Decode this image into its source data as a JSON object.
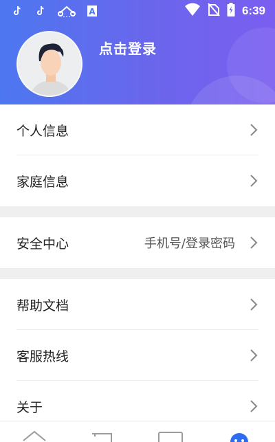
{
  "status_bar": {
    "time": "6:39",
    "icons": [
      "tiktok-icon",
      "tiktok-icon",
      "cast-icon",
      "keyboard-a-icon",
      "wifi-icon",
      "no-sim-icon",
      "battery-icon"
    ]
  },
  "header": {
    "login_text": "点击登录",
    "avatar": "default-avatar"
  },
  "menu": {
    "group1": [
      {
        "label": "个人信息"
      },
      {
        "label": "家庭信息"
      }
    ],
    "group2": [
      {
        "label": "安全中心",
        "value": "手机号/登录密码"
      }
    ],
    "group3": [
      {
        "label": "帮助文档"
      },
      {
        "label": "客服热线"
      },
      {
        "label": "关于"
      }
    ]
  },
  "tabbar": {
    "icons": [
      "home-icon",
      "device-icon",
      "screen-icon",
      "profile-icon"
    ]
  },
  "colors": {
    "header_start": "#4d77f0",
    "header_end": "#7a5ef0",
    "accent": "#2f6bf0"
  }
}
